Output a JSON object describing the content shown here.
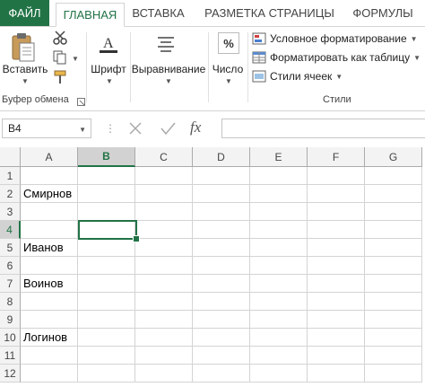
{
  "tabs": {
    "file": "ФАЙЛ",
    "items": [
      "ГЛАВНАЯ",
      "ВСТАВКА",
      "РАЗМЕТКА СТРАНИЦЫ",
      "ФОРМУЛЫ"
    ],
    "active_index": 0
  },
  "ribbon": {
    "clipboard": {
      "paste_label": "Вставить",
      "group_label": "Буфер обмена"
    },
    "font": {
      "label": "Шрифт"
    },
    "alignment": {
      "label": "Выравнивание"
    },
    "number": {
      "label": "Число",
      "icon_text": "%"
    },
    "styles": {
      "conditional": "Условное форматирование",
      "format_table": "Форматировать как таблицу",
      "cell_styles": "Стили ячеек",
      "group_label": "Стили"
    }
  },
  "formula_bar": {
    "name_box": "B4",
    "fx_label": "fx",
    "value": ""
  },
  "grid": {
    "columns": [
      "A",
      "B",
      "C",
      "D",
      "E",
      "F",
      "G"
    ],
    "rows": [
      "1",
      "2",
      "3",
      "4",
      "5",
      "6",
      "7",
      "8",
      "9",
      "10",
      "11",
      "12"
    ],
    "selected_cell": "B4",
    "cells": {
      "A2": "Смирнов",
      "A5": "Иванов",
      "A7": "Воинов",
      "A10": "Логинов"
    }
  },
  "colors": {
    "accent": "#217346",
    "header_bg": "#f3f3f3",
    "header_selected": "#d2d2d2",
    "gridline": "#d4d4d4"
  }
}
